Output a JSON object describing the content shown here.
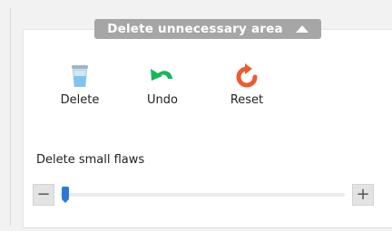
{
  "section": {
    "title": "Delete unnecessary area",
    "collapse_icon": "caret-up-icon"
  },
  "tools": {
    "delete": {
      "label": "Delete",
      "icon": "trash-bin-icon"
    },
    "undo": {
      "label": "Undo",
      "icon": "undo-arrow-icon"
    },
    "reset": {
      "label": "Reset",
      "icon": "reset-circular-arrow-icon"
    }
  },
  "small_flaws": {
    "label": "Delete small flaws",
    "minus_label": "−",
    "plus_label": "+",
    "value_fraction": 0.02
  },
  "colors": {
    "header_bg": "#a6a6a6",
    "undo_icon": "#14b85a",
    "reset_icon": "#ef5a32",
    "slider_thumb": "#2b7bd6"
  }
}
